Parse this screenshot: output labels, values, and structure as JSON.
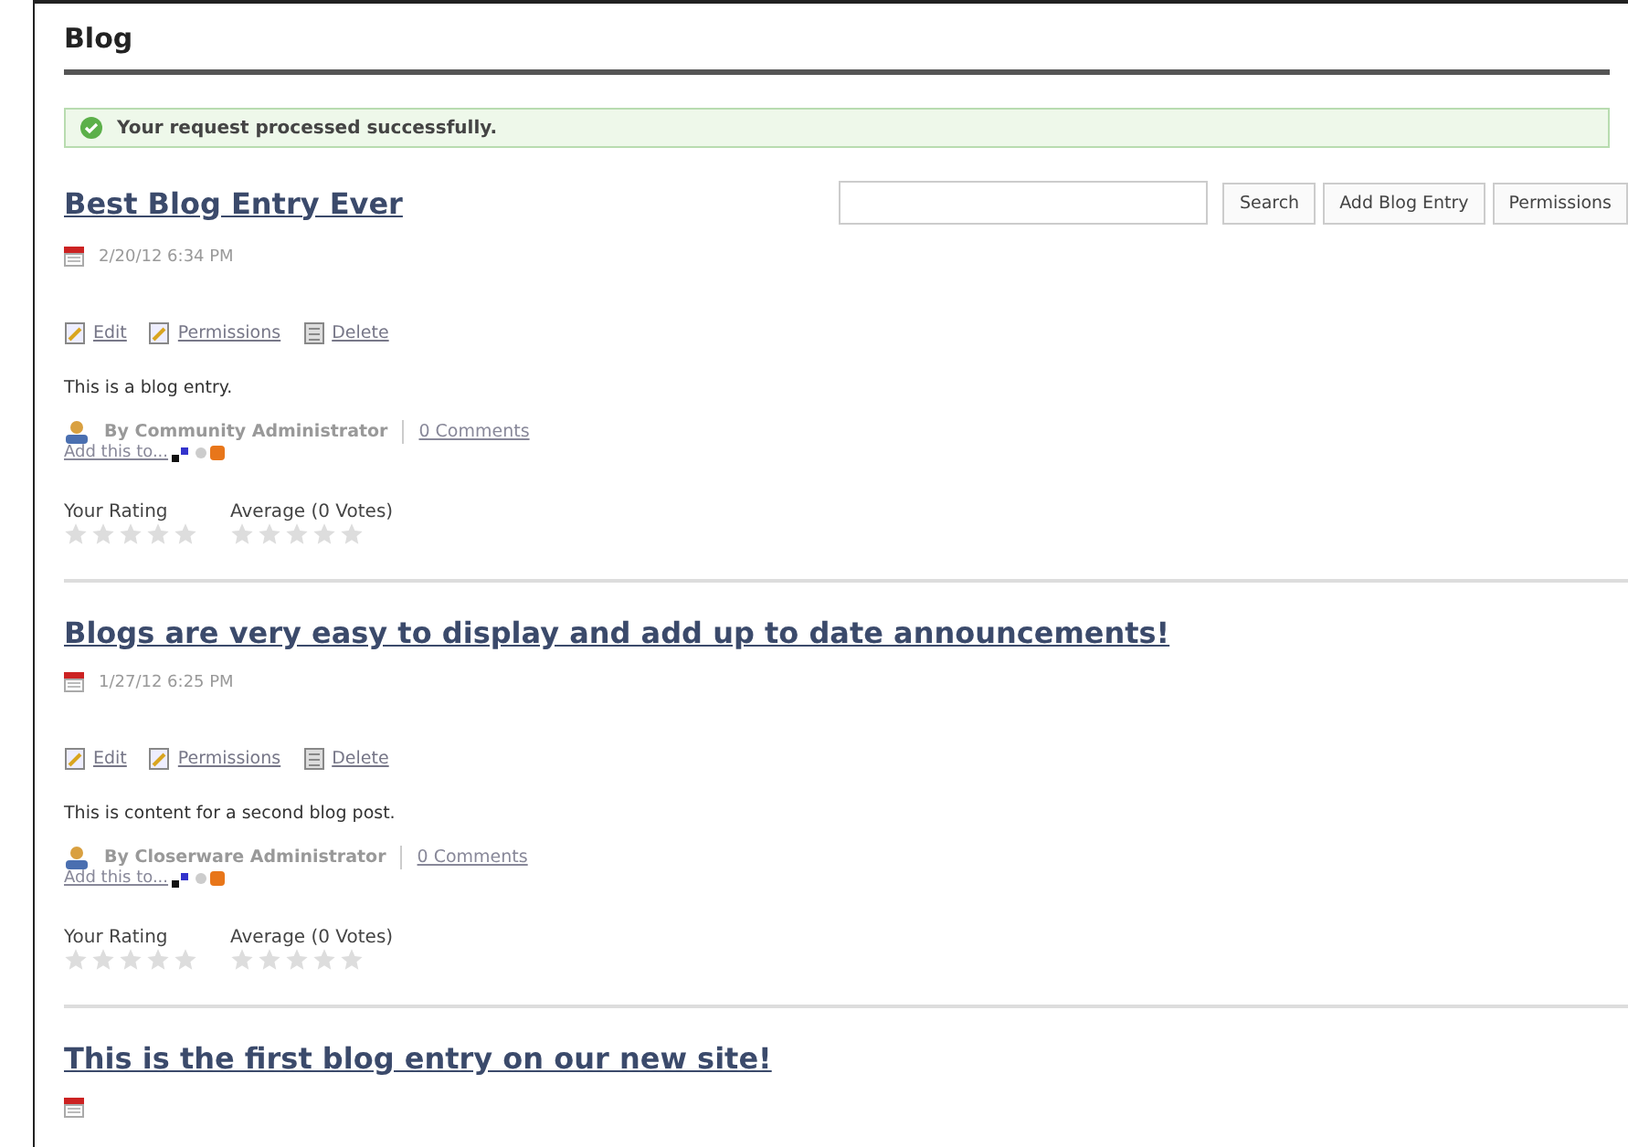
{
  "page_title": "Blog",
  "message": "Your request processed successfully.",
  "toolbar": {
    "buttons": [
      "Search",
      "Add Blog Entry",
      "Permissions"
    ]
  },
  "entries": [
    {
      "title": "Best Blog Entry Ever",
      "date": "2/20/12 6:34 PM",
      "actions": [
        "Edit",
        "Permissions",
        "Delete"
      ],
      "body": "This is a blog entry.",
      "author": "By Community Administrator",
      "comments": "0 Comments",
      "share": "Add this to...",
      "your_rating_label": "Your Rating",
      "average_label": "Average (0 Votes)",
      "your_rating": {
        "stars": 0
      },
      "average": {
        "stars": 0
      }
    },
    {
      "title": "Blogs are very easy to display and add up to date announcements!",
      "date": "1/27/12 6:25 PM",
      "actions": [
        "Edit",
        "Permissions",
        "Delete"
      ],
      "body": "This is content for a second blog post.",
      "author": "By Closerware Administrator",
      "comments": "0 Comments",
      "share": "Add this to...",
      "your_rating_label": "Your Rating",
      "average_label": "Average (0 Votes)",
      "your_rating": {
        "stars": 0
      },
      "average": {
        "stars": 0
      }
    },
    {
      "title": "This is the first blog entry on our new site!"
    }
  ]
}
